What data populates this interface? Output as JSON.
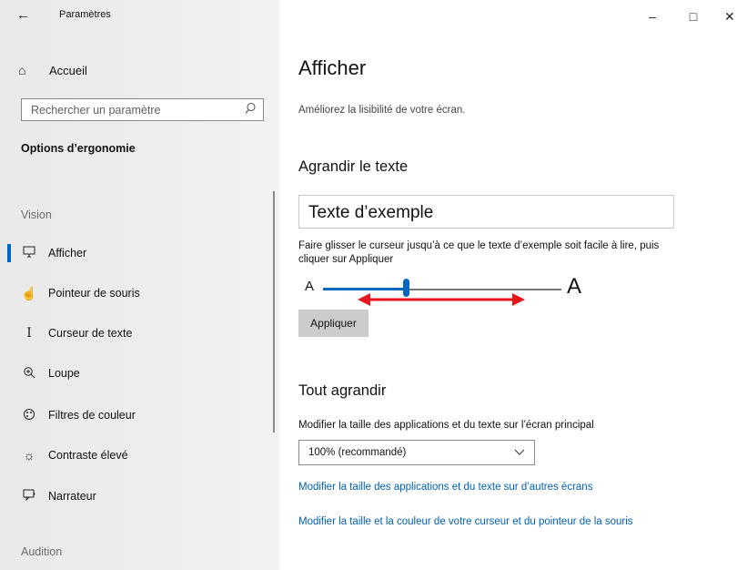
{
  "window": {
    "title": "Paramètres",
    "back_glyph": "←",
    "minimize_glyph": "–",
    "maximize_glyph": "□",
    "close_glyph": "✕"
  },
  "sidebar": {
    "home": {
      "icon": "home-icon",
      "glyph": "⌂",
      "label": "Accueil"
    },
    "search": {
      "placeholder": "Rechercher un paramètre",
      "icon": "search-icon"
    },
    "section_title": "Options d’ergonomie",
    "group_vision": "Vision",
    "group_audition": "Audition",
    "items": [
      {
        "icon": "monitor-icon",
        "glyph": "🖵",
        "label": "Afficher",
        "selected": true
      },
      {
        "icon": "mouse-pointer-icon",
        "glyph": "☝",
        "label": "Pointeur de souris"
      },
      {
        "icon": "text-cursor-icon",
        "glyph": "I",
        "label": "Curseur de texte"
      },
      {
        "icon": "magnifier-icon",
        "glyph": "⊕",
        "label": "Loupe"
      },
      {
        "icon": "color-filter-icon",
        "glyph": "◎",
        "label": "Filtres de couleur"
      },
      {
        "icon": "high-contrast-icon",
        "glyph": "☼",
        "label": "Contraste élevé"
      },
      {
        "icon": "narrator-icon",
        "glyph": "▭",
        "label": "Narrateur"
      }
    ]
  },
  "main": {
    "title": "Afficher",
    "description": "Améliorez la lisibilité de votre écran.",
    "text_section": {
      "heading": "Agrandir le texte",
      "sample_text": "Texte d’exemple",
      "instruction": "Faire glisser le curseur jusqu’à ce que le texte d’exemple soit facile à lire, puis cliquer sur Appliquer",
      "slider_min_label": "A",
      "slider_max_label": "A",
      "slider_value_fraction": 0.43,
      "apply_label": "Appliquer"
    },
    "scale_section": {
      "heading": "Tout agrandir",
      "description": "Modifier la taille des applications et du texte sur l’écran principal",
      "dropdown_value": "100% (recommandé)",
      "link_other_screens": "Modifier la taille des applications et du texte sur d’autres écrans",
      "link_cursor": "Modifier la taille et la couleur de votre curseur et du pointeur de la souris"
    }
  },
  "colors": {
    "accent": "#0067c0",
    "link": "#0060b6",
    "annotation_arrow": "#e8161b"
  }
}
